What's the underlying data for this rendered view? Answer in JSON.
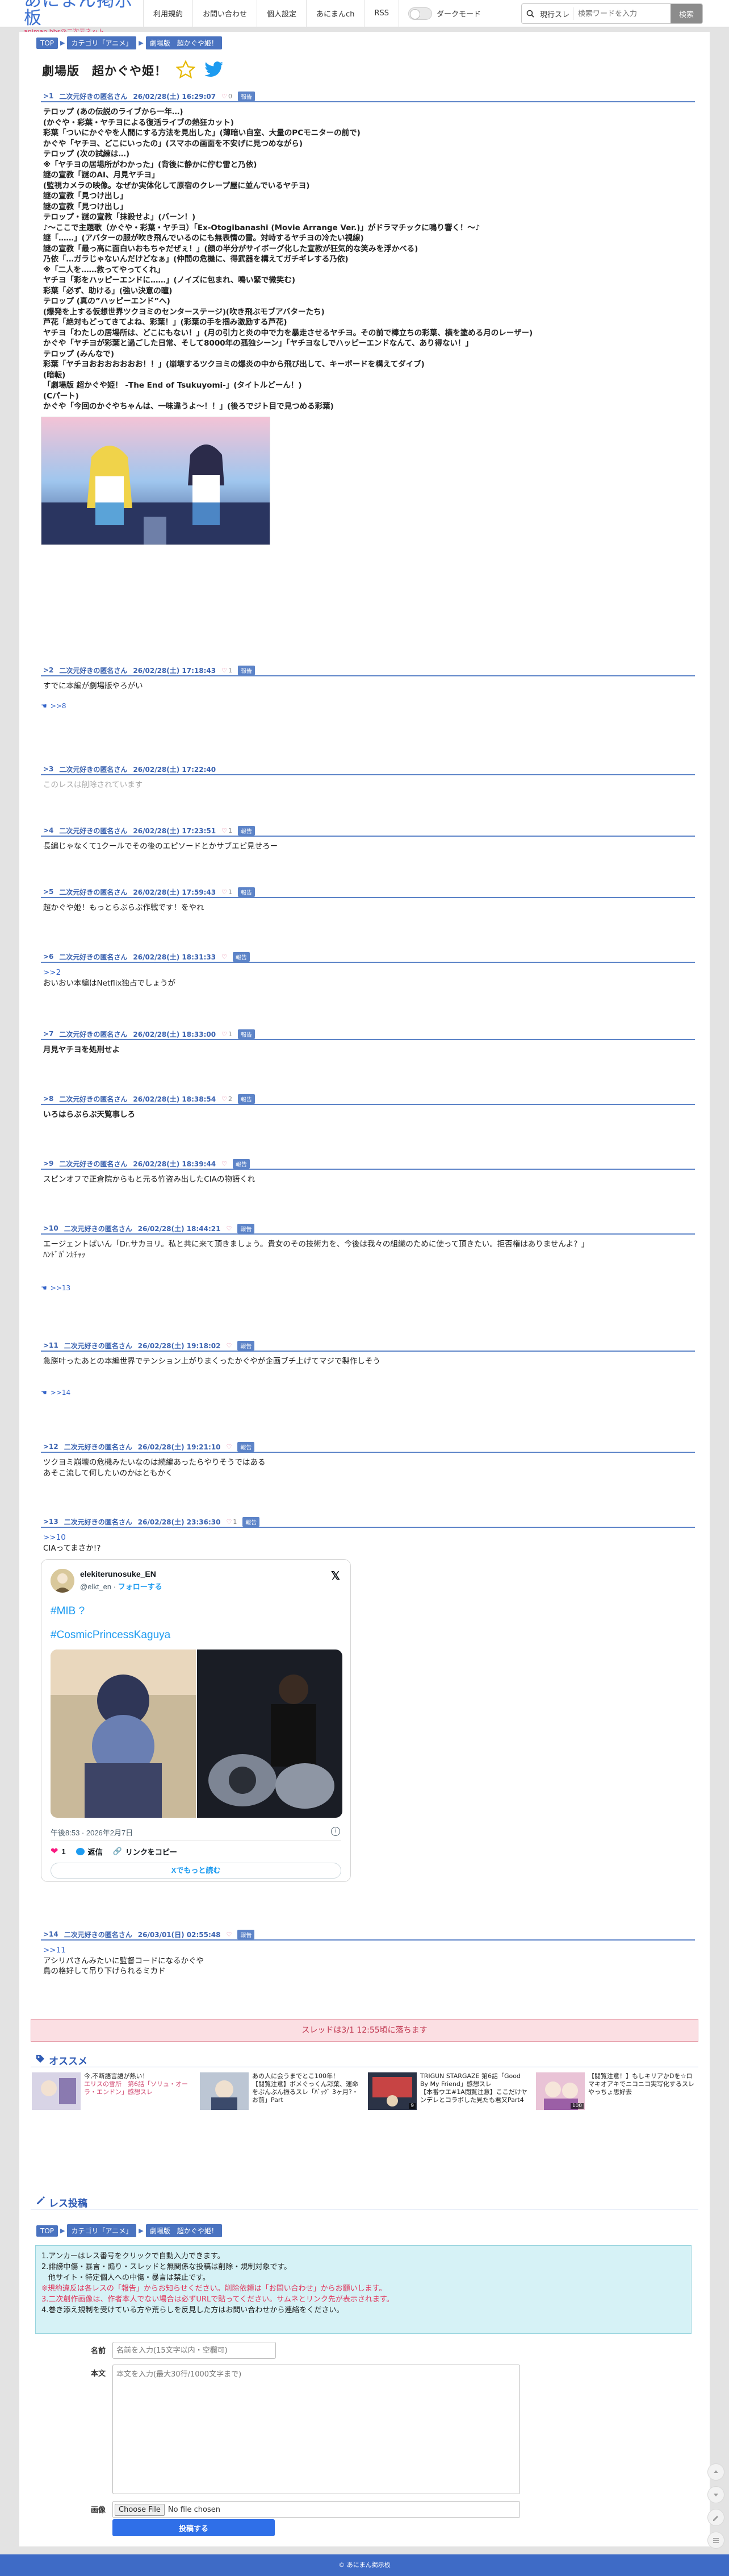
{
  "header": {
    "logo_title": "あにまん掲示板",
    "logo_sub": "animan bbs@二次元ネット",
    "nav": [
      "利用規約",
      "お問い合わせ",
      "個人設定",
      "あにまんch",
      "RSS"
    ],
    "dark_mode_label": "ダークモード",
    "search_scope": "現行スレ",
    "search_placeholder": "検索ワードを入力",
    "search_button": "検索"
  },
  "breadcrumb": [
    "TOP",
    "カテゴリ「アニメ」",
    "劇場版　超かぐや姫！"
  ],
  "thread": {
    "title": "劇場版　超かぐや姫！"
  },
  "posts": [
    {
      "num": ">1",
      "name": "二次元好きの匿名さん",
      "date": "26/02/28(土) 16:29:07",
      "likes": "0",
      "report": "報告",
      "lines": [
        "テロップ (あの伝説のライブから一年…)",
        "(かぐや・彩葉・ヤチヨによる復活ライブの熱狂カット)",
        "彩葉「ついにかぐやを人間にする方法を見出した」(薄暗い自室、大量のPCモニターの前で)",
        "かぐや「ヤチヨ、どこにいったの」(スマホの画面を不安げに見つめながら)",
        "テロップ (次の試練は…)",
        "※「ヤチヨの居場所がわかった」(背後に静かに佇む雷と乃依)",
        "謎の宣教「謎のAI、月見ヤチヨ」",
        "(監視カメラの映像。なぜか実体化して原宿のクレープ屋に並んでいるヤチヨ)",
        "謎の宣教「見つけ出し」",
        "謎の宣教「見つけ出し」",
        "テロップ・謎の宣教「抹殺せよ」(バーン！)",
        "♪〜ここで主題歌（かぐや・彩葉・ヤチヨ）「Ex-Otogibanashi (Movie Arrange Ver.)」がドラマチックに鳴り響く！〜♪",
        "謎「……」(アバターの服が吹き飛んでいるのにも無表情の雷。対峙するヤチヨの冷たい視線)",
        "謎の宣教「最っ高に面白いおもちゃだぜぇ！」(顔の半分がサイボーグ化した宣教が狂気的な笑みを浮かべる)",
        "乃依「…ガラじゃないんだけどなぁ」(仲間の危機に、得武器を構えてガチギレする乃依)",
        "※「二人を……救ってやってくれ」",
        "ヤチヨ「彩をハッピーエンドに……」(ノイズに包まれ、鳴い緊で微笑む)",
        "彩葉「必ず、助ける」(強い決意の瞳)",
        "テロップ (真の”ハッピーエンド”へ)",
        "(爆発を上する仮想世界ツクヨミのセンターステージ)(吹き飛ぶモブアバターたち)",
        "芦花「絶対もどってきてよね、彩葉！」(彩葉の手を掴み激励する芦花)",
        "ヤチヨ「わたしの居場所は、どこにもない！」(月の引力と炎の中で力を暴走させるヤチヨ。その前で棒立ちの彩葉、横を塗める月のレーザー)",
        "かぐや「ヤチヨが彩葉と過ごした日常、そして8000年の孤独シーン」「ヤチヨなしでハッピーエンドなんて、あり得ない！」",
        "テロップ (みんなで)",
        "彩葉「ヤチヨおおおおおおお！！」(崩壊するツクヨミの爆炎の中から飛び出して、キーボードを構えてダイブ)",
        "(暗転)",
        "「劇場版 超かぐや姫！ -The End of Tsukuyomi-」(タイトルどーん！)",
        "(Cパート)",
        "かぐや「今回のかぐやちゃんは、一味違うよ〜！！」(後ろでジト目で見つめる彩葉)"
      ]
    },
    {
      "num": ">2",
      "name": "二次元好きの匿名さん",
      "date": "26/02/28(土) 17:18:43",
      "likes": "1",
      "report": "報告",
      "lines": [
        "すでに本編が劇場版やろがい"
      ],
      "replies": ">>8"
    },
    {
      "num": ">3",
      "name": "二次元好きの匿名さん",
      "date": "26/02/28(土) 17:22:40",
      "lines": [
        "このレスは削除されています"
      ]
    },
    {
      "num": ">4",
      "name": "二次元好きの匿名さん",
      "date": "26/02/28(土) 17:23:51",
      "likes": "1",
      "report": "報告",
      "lines": [
        "長編じゃなくて1クールでその後のエピソードとかサブエピ見せろー"
      ]
    },
    {
      "num": ">5",
      "name": "二次元好きの匿名さん",
      "date": "26/02/28(土) 17:59:43",
      "likes": "1",
      "report": "報告",
      "lines": [
        "超かぐや姫！もっとらぶらぶ作戦です！をやれ"
      ]
    },
    {
      "num": ">6",
      "name": "二次元好きの匿名さん",
      "date": "26/02/28(土) 18:31:33",
      "likes": "",
      "report": "報告",
      "anchor": ">>2",
      "lines": [
        "おいおい本編はNetflix独占でしょうが"
      ]
    },
    {
      "num": ">7",
      "name": "二次元好きの匿名さん",
      "date": "26/02/28(土) 18:33:00",
      "likes": "1",
      "report": "報告",
      "lines": [
        "月見ヤチヨを処刑せよ"
      ]
    },
    {
      "num": ">8",
      "name": "二次元好きの匿名さん",
      "date": "26/02/28(土) 18:38:54",
      "likes": "2",
      "report": "報告",
      "lines": [
        "いろはらぶらぶ天覧事しろ"
      ]
    },
    {
      "num": ">9",
      "name": "二次元好きの匿名さん",
      "date": "26/02/28(土) 18:39:44",
      "likes": "",
      "report": "報告",
      "lines": [
        "スピンオフで正倉院からもと元る竹盗み出したCIAの物語くれ"
      ]
    },
    {
      "num": ">10",
      "name": "二次元好きの匿名さん",
      "date": "26/02/28(土) 18:44:21",
      "likes": "",
      "report": "報告",
      "lines": [
        "エージェントぱいん「Dr.サカヨリ。私と共に来て頂きましょう。貴女のその技術力を、今後は我々の組織のために使って頂きたい。拒否権はありませんよ？」",
        "ﾊﾝﾄﾞｶﾞﾝｶﾁｬｯ"
      ],
      "replies": ">>13"
    },
    {
      "num": ">11",
      "name": "二次元好きの匿名さん",
      "date": "26/02/28(土) 19:18:02",
      "likes": "",
      "report": "報告",
      "lines": [
        "急勝叶ったあとの本編世界でテンション上がりまくったかぐやが企画ブチ上げてマジで製作しそう"
      ],
      "replies": ">>14"
    },
    {
      "num": ">12",
      "name": "二次元好きの匿名さん",
      "date": "26/02/28(土) 19:21:10",
      "likes": "",
      "report": "報告",
      "lines": [
        "ツクヨミ崩壊の危機みたいなのは続編あったらやりそうではある",
        "あそこ流して何したいのかはともかく"
      ]
    },
    {
      "num": ">13",
      "name": "二次元好きの匿名さん",
      "date": "26/02/28(土) 23:36:30",
      "likes": "1",
      "report": "報告",
      "anchor": ">>10",
      "lines": [
        "CIAってまさか!?"
      ]
    },
    {
      "num": ">14",
      "name": "二次元好きの匿名さん",
      "date": "26/03/01(日) 02:55:48",
      "likes": "",
      "report": "報告",
      "anchor": ">>11",
      "lines": [
        "アシリパさんみたいに監督コードになるかぐや",
        "鳥の格好して吊り下げられるミカド"
      ]
    }
  ],
  "tweet": {
    "name": "elekiterunosuke_EN",
    "handle": "@elkt_en",
    "follow": "フォローする",
    "line1": "#MIB ?",
    "line2": "#CosmicPrincessKaguya",
    "time": "午後8:53 · 2026年2月7日",
    "like_count": "1",
    "reply": "返信",
    "copy": "リンクをコピー",
    "more": "Xでもっと読む"
  },
  "notice": "スレッドは3/1 12:55頃に落ちます",
  "recommend": {
    "title": "オススメ",
    "items": [
      {
        "l1": "今,不断語言語が熱い！",
        "l2": "エリスの雪所　第6話「ソリュ・オーラ・エンドン」感想スレ",
        "count": ""
      },
      {
        "l1": "あの人に会うまでとこ100年！",
        "l2": "【閲覧注意】ボメぐっくん彩葉、運命をぶんぶん振るスレ「ﾊﾞｯｸﾞ 3ヶ月?・お前」Part",
        "count": ""
      },
      {
        "l1": "TRIGUN STARGAZE 第6話「Good By My Friend」感想スレ",
        "l2": "【本番ウエ#1A閲覧注意】ここだけヤンデレとコラボした見たも君又Part4",
        "count": "9"
      },
      {
        "l1": "【閲覧注意！】もしキリアかDを☆ロマキオアキでニコニコ実写化するスレ",
        "l2": "やっちょ思好去",
        "count": "100"
      }
    ]
  },
  "form": {
    "title": "レス投稿",
    "breadcrumb": [
      "TOP",
      "カテゴリ「アニメ」",
      "劇場版　超かぐや姫！"
    ],
    "rules": [
      "1.アンカーはレス番号をクリックで自動入力できます。",
      "2.誹謗中傷・暴言・煽り・スレッドと無関係な投稿は削除・規制対象です。",
      "他サイト・特定個人への中傷・暴言は禁止です。",
      "※規約違反は各レスの「報告」からお知らせください。削除依頼は「お問い合わせ」からお願いします。",
      "3.二次創作画像は、作者本人でない場合は必ずURLで貼ってください。サムネとリンク先が表示されます。",
      "4.巻き添え規制を受けている方や荒らしを反見した方はお問い合わせから連絡をください。"
    ],
    "name_label": "名前",
    "name_placeholder": "名前を入力(15文字以内・空欄可)",
    "body_label": "本文",
    "body_placeholder": "本文を入力(最大30行/1000文字まで)",
    "image_label": "画像",
    "file_button": "Choose File",
    "file_status": "No file chosen",
    "submit": "投稿する"
  },
  "footer": "© あにまん掲示板",
  "colors": {
    "accent": "#3e6bc6",
    "like": "#e3779a",
    "notice_bg": "#fbdfe3"
  }
}
